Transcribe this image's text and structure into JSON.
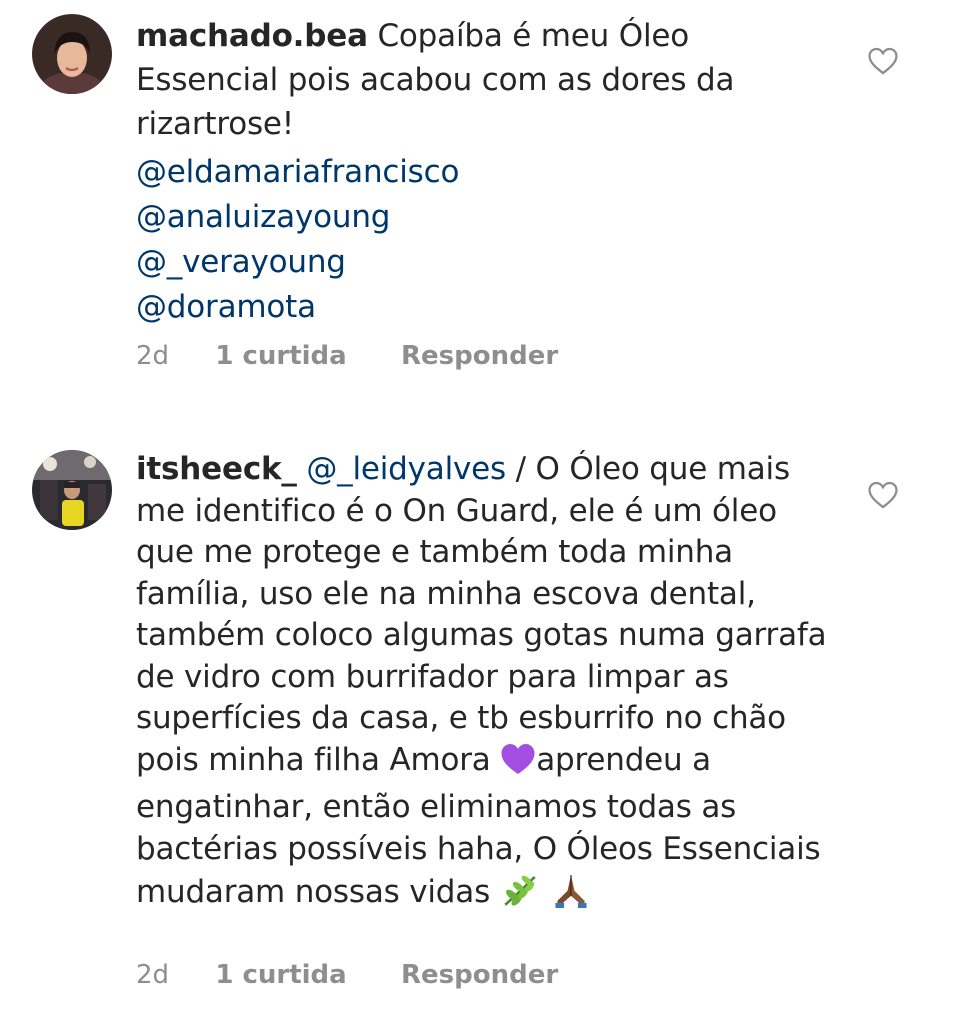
{
  "comments": [
    {
      "username": "machado.bea",
      "text": "Copaíba é meu Óleo Essencial pois acabou com as dores da rizartrose!",
      "mentions": [
        "@eldamariafrancisco",
        "@analuizayoung",
        "@_verayoung",
        "@doramota"
      ],
      "time": "2d",
      "likes": "1 curtida",
      "reply_label": "Responder"
    },
    {
      "username": "itsheeck_",
      "mention": "@_leidyalves",
      "text_before_emoji": " / O Óleo que mais me identifico é o On Guard, ele é um óleo que me protege e também toda minha família, uso ele na minha escova dental, também  coloco algumas gotas numa garrafa de vidro com burrifador para limpar as superfícies da casa, e tb esburrifo no chão pois minha filha Amora ",
      "text_after_emoji": "aprendeu a engatinhar, então eliminamos todas as bactérias possíveis haha, O Óleos Essenciais mudaram nossas vidas ",
      "emojis": [
        "purple-heart-icon",
        "herb-icon",
        "folded-hands-icon"
      ],
      "time": "2d",
      "likes": "1 curtida",
      "reply_label": "Responder"
    }
  ]
}
